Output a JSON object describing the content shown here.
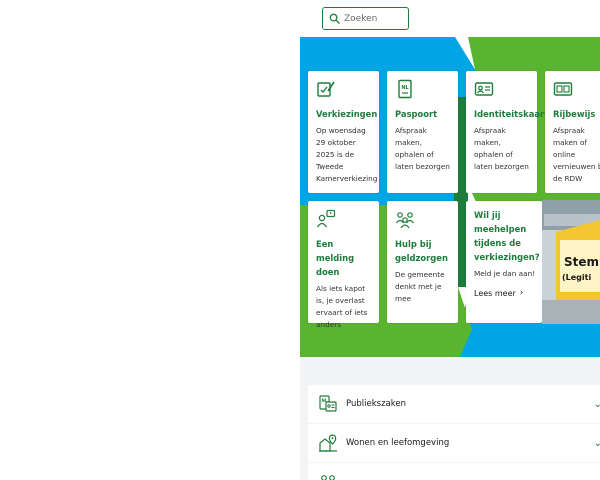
{
  "search": {
    "placeholder": "Zoeken",
    "icon": "search-icon"
  },
  "colors": {
    "accent_green": "#1e7d3c",
    "hero_blue": "#00a5e4",
    "hero_green": "#59b530",
    "background_grey": "#f2f4f5"
  },
  "cards": [
    {
      "icon": "ballot-pen-icon",
      "title": "Verkiezingen",
      "description": "Op woensdag 29 oktober 2025 is de Tweede Kamerverkiezing"
    },
    {
      "icon": "passport-icon",
      "title": "Paspoort",
      "description": "Afspraak maken, ophalen of laten bezorgen"
    },
    {
      "icon": "id-card-icon",
      "title": "Identiteitskaart",
      "description": "Afspraak maken, ophalen of laten bezorgen"
    },
    {
      "icon": "drivers-license-icon",
      "title": "Rijbewijs",
      "description": "Afspraak maken of online vernieuwen bij de RDW"
    },
    {
      "icon": "report-icon",
      "title": "Een melding doen",
      "description": "Als iets kapot is, je overlast ervaart of iets anders"
    },
    {
      "icon": "people-help-icon",
      "title": "Hulp bij geldzorgen",
      "description": "De gemeente denkt met je mee"
    },
    {
      "title": "Wil jij meehelpen tijdens de verkiezingen?",
      "description": "Meld je dan aan!",
      "link": "Lees meer"
    }
  ],
  "photo": {
    "sign_text_1": "Stem",
    "sign_text_2": "(Legiti"
  },
  "sections": [
    {
      "icon": "documents-icon",
      "label": "Publiekszaken"
    },
    {
      "icon": "house-location-icon",
      "label": "Wonen en leefomgeving"
    },
    {
      "icon": "people-icon",
      "label": ""
    }
  ]
}
